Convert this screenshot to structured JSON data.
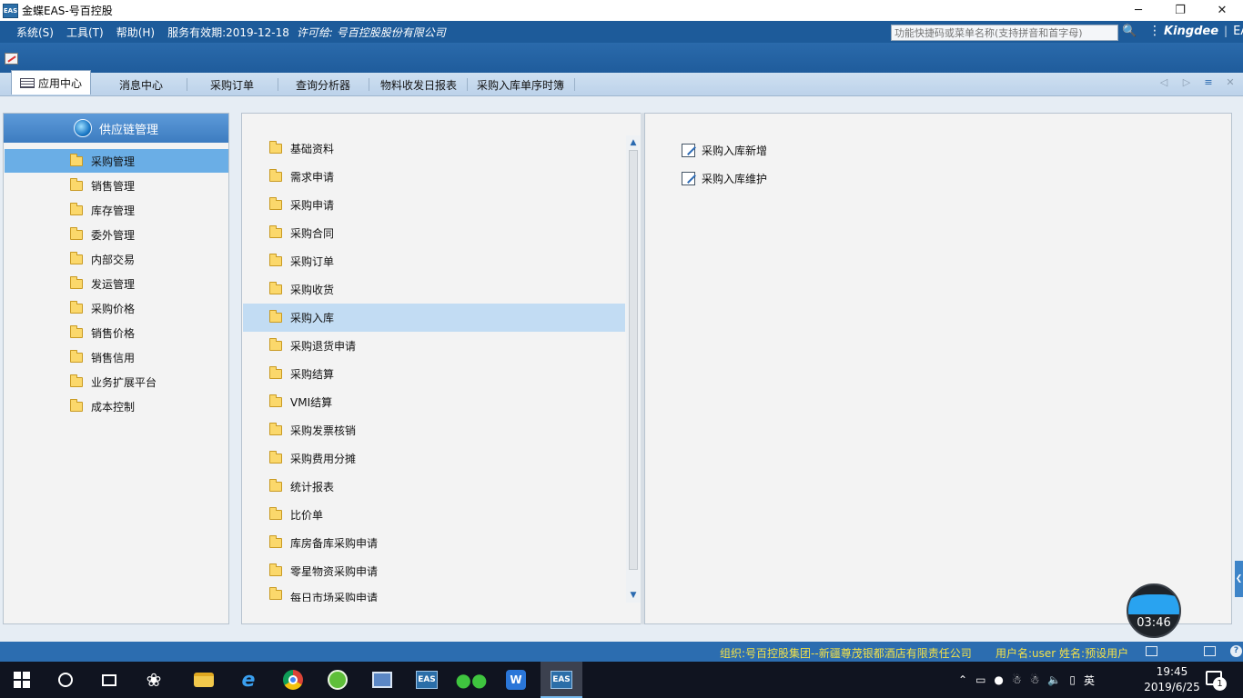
{
  "window": {
    "app_icon_text": "EAS",
    "title": "金蝶EAS-号百控股",
    "controls": [
      "─",
      "❐",
      "✕"
    ]
  },
  "menubar": {
    "items": [
      "系统(S)",
      "工具(T)",
      "帮助(H)"
    ],
    "service_text": "服务有效期:2019-12-18",
    "licensee_text": "许可给:  号百控股股份有限公司",
    "search_placeholder": "功能快捷码或菜单名称(支持拼音和首字母)",
    "brand": "Kingdee",
    "product": "EAS"
  },
  "tabs": [
    {
      "label": "应用中心",
      "active": true
    },
    {
      "label": "消息中心",
      "active": false
    },
    {
      "label": "采购订单",
      "active": false
    },
    {
      "label": "查询分析器",
      "active": false
    },
    {
      "label": "物料收发日报表",
      "active": false
    },
    {
      "label": "采购入库单序时簿",
      "active": false
    }
  ],
  "left_panel": {
    "header": "供应链管理",
    "items": [
      {
        "label": "采购管理",
        "selected": true
      },
      {
        "label": "销售管理",
        "selected": false
      },
      {
        "label": "库存管理",
        "selected": false
      },
      {
        "label": "委外管理",
        "selected": false
      },
      {
        "label": "内部交易",
        "selected": false
      },
      {
        "label": "发运管理",
        "selected": false
      },
      {
        "label": "采购价格",
        "selected": false
      },
      {
        "label": "销售价格",
        "selected": false
      },
      {
        "label": "销售信用",
        "selected": false
      },
      {
        "label": "业务扩展平台",
        "selected": false
      },
      {
        "label": "成本控制",
        "selected": false
      }
    ]
  },
  "middle_panel": {
    "items": [
      {
        "label": "基础资料",
        "selected": false
      },
      {
        "label": "需求申请",
        "selected": false
      },
      {
        "label": "采购申请",
        "selected": false
      },
      {
        "label": "采购合同",
        "selected": false
      },
      {
        "label": "采购订单",
        "selected": false
      },
      {
        "label": "采购收货",
        "selected": false
      },
      {
        "label": "采购入库",
        "selected": true
      },
      {
        "label": "采购退货申请",
        "selected": false
      },
      {
        "label": "采购结算",
        "selected": false
      },
      {
        "label": "VMI结算",
        "selected": false
      },
      {
        "label": "采购发票核销",
        "selected": false
      },
      {
        "label": "采购费用分摊",
        "selected": false
      },
      {
        "label": "统计报表",
        "selected": false
      },
      {
        "label": "比价单",
        "selected": false
      },
      {
        "label": "库房备库采购申请",
        "selected": false
      },
      {
        "label": "零星物资采购申请",
        "selected": false
      },
      {
        "label": "每日市场采购申请",
        "selected": false
      }
    ]
  },
  "right_panel": {
    "items": [
      "采购入库新增",
      "采购入库维护"
    ]
  },
  "timer": {
    "time": "03:46"
  },
  "statusbar": {
    "org_text": "组织:号百控股集团--新疆尊茂银都酒店有限责任公司",
    "user_text": "用户名:user 姓名:预设用户"
  },
  "taskbar": {
    "ime": "英",
    "time": "19:45",
    "date": "2019/6/25",
    "notification_count": "1",
    "apps": [
      "file-explorer",
      "internet-explorer",
      "chrome",
      "360-browser",
      "remote-desktop",
      "eas",
      "wechat",
      "wps",
      "eas-active"
    ]
  }
}
